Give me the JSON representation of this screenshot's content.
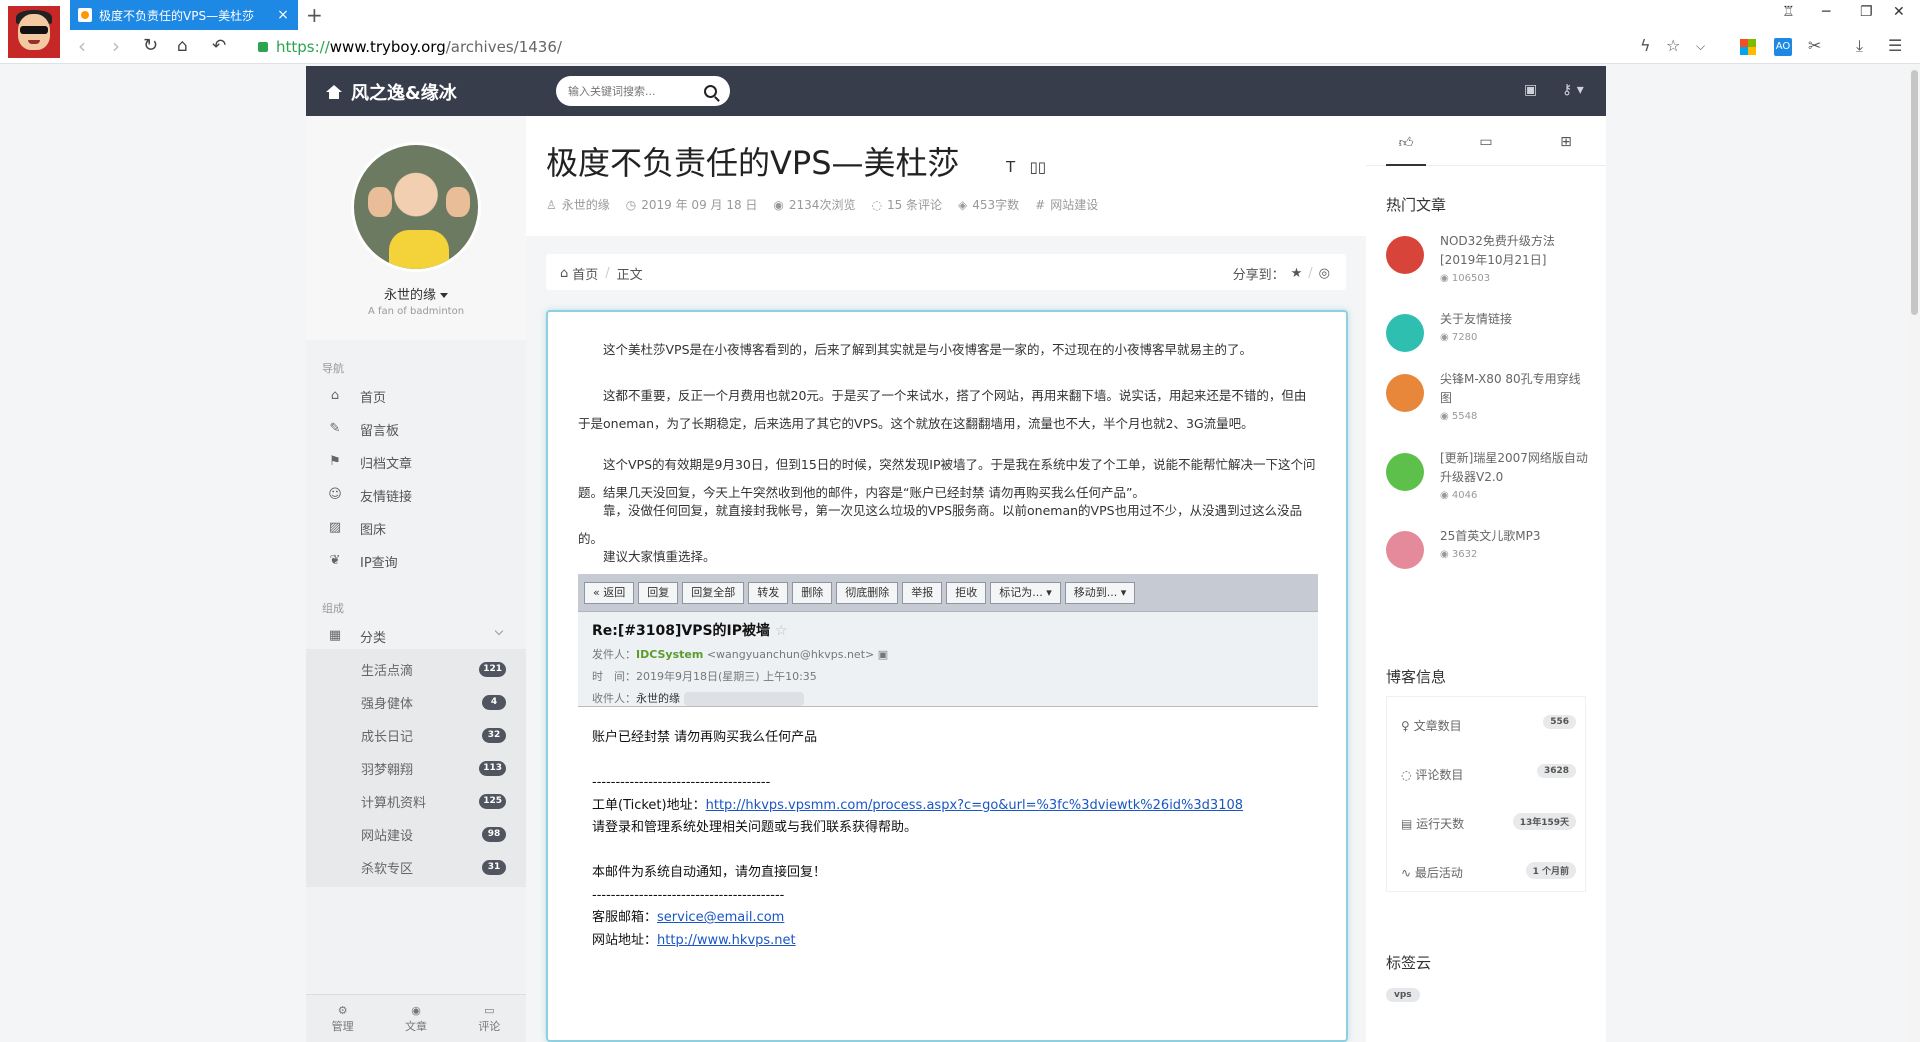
{
  "browser": {
    "tab_title": "极度不负责任的VPS—美杜莎",
    "url_scheme": "https://",
    "url_host": "www.tryboy.org",
    "url_path": "/archives/1436/",
    "new_tab": "+"
  },
  "header": {
    "brand": "风之逸&缘冰",
    "search_placeholder": "输入关键词搜索..."
  },
  "profile": {
    "name": "永世的缘",
    "desc": "A fan of badminton"
  },
  "nav": {
    "section_nav": "导航",
    "items": [
      {
        "label": "首页",
        "icon": "home-icon"
      },
      {
        "label": "留言板",
        "icon": "edit-icon"
      },
      {
        "label": "归档文章",
        "icon": "archive-icon"
      },
      {
        "label": "友情链接",
        "icon": "friends-icon"
      },
      {
        "label": "图床",
        "icon": "image-icon"
      },
      {
        "label": "IP查询",
        "icon": "twitter-icon"
      }
    ],
    "section_group": "组成",
    "category_label": "分类",
    "categories": [
      {
        "label": "生活点滴",
        "count": "121"
      },
      {
        "label": "强身健体",
        "count": "4"
      },
      {
        "label": "成长日记",
        "count": "32"
      },
      {
        "label": "羽梦翱翔",
        "count": "113"
      },
      {
        "label": "计算机资料",
        "count": "125"
      },
      {
        "label": "网站建设",
        "count": "98"
      },
      {
        "label": "杀软专区",
        "count": "31"
      }
    ],
    "footer": {
      "manage": "管理",
      "articles": "文章",
      "comments": "评论"
    }
  },
  "article": {
    "title": "极度不负责任的VPS—美杜莎",
    "meta": {
      "author": "永世的缘",
      "date": "2019 年 09 月 18 日",
      "views": "2134次浏览",
      "comments": "15 条评论",
      "words": "453字数",
      "category": "网站建设"
    },
    "breadcrumb": {
      "home": "首页",
      "current": "正文"
    },
    "share_label": "分享到：",
    "paragraphs": [
      "这个美杜莎VPS是在小夜博客看到的，后来了解到其实就是与小夜博客是一家的，不过现在的小夜博客早就易主的了。",
      "这都不重要，反正一个月费用也就20元。于是买了一个来试水，搭了个网站，再用来翻下墙。说实话，用起来还是不错的，但由于是oneman，为了长期稳定，后来选用了其它的VPS。这个就放在这翻翻墙用，流量也不大，半个月也就2、3G流量吧。",
      "这个VPS的有效期是9月30日，但到15日的时候，突然发现IP被墙了。于是我在系统中发了个工单，说能不能帮忙解决一下这个问题。结果几天没回复，今天上午突然收到他的邮件，内容是“账户已经封禁 请勿再购买我么任何产品”。",
      "靠，没做任何回复，就直接封我帐号，第一次见这么垃圾的VPS服务商。以前oneman的VPS也用过不少，从没遇到过这么没品的。",
      "建议大家慎重选择。"
    ],
    "email": {
      "toolbar": [
        "« 返回",
        "回复",
        "回复全部",
        "转发",
        "删除",
        "彻底删除",
        "举报",
        "拒收",
        "标记为... ▾",
        "移动到... ▾"
      ],
      "subject": "Re:[#3108]VPS的IP被墙",
      "from_label": "发件人：",
      "from_name": "IDCSystem",
      "from_addr": "<wangyuanchun@hkvps.net>",
      "time_label": "时　间：",
      "time": "2019年9月18日(星期三) 上午10:35",
      "to_label": "收件人：",
      "to": "永世的缘",
      "body_line1": "账户已经封禁 请勿再购买我么任何产品",
      "divider": "--------------------------------------",
      "ticket_label": "工单(Ticket)地址：",
      "ticket_url": "http://hkvps.vpsmm.com/process.aspx?c=go&url=%3fc%3dviewtk%26id%3d3108",
      "body_line2": "请登录和管理系统处理相关问题或与我们联系获得帮助。",
      "body_line3": "本邮件为系统自动通知，请勿直接回复！",
      "divider2": "-----------------------------------------",
      "service_label": "客服邮箱：",
      "service_email": "service@email.com",
      "site_label": "网站地址：",
      "site_url": "http://www.hkvps.net"
    }
  },
  "sidebar": {
    "hot_title": "热门文章",
    "hot": [
      {
        "title": "NOD32免费升级方法[2019年10月21日]",
        "views": "106503",
        "color": "#d9443a"
      },
      {
        "title": "关于友情链接",
        "views": "7280",
        "color": "#2fbfb0"
      },
      {
        "title": "尖锋M-X80 80孔专用穿线图",
        "views": "5548",
        "color": "#e8873a"
      },
      {
        "title": "[更新]瑞星2007网络版自动升级器V2.0",
        "views": "4046",
        "color": "#5cc04a"
      },
      {
        "title": "25首英文儿歌MP3",
        "views": "3632",
        "color": "#e58a9a"
      }
    ],
    "info_title": "博客信息",
    "info": [
      {
        "label": "文章数目",
        "value": "556"
      },
      {
        "label": "评论数目",
        "value": "3628"
      },
      {
        "label": "运行天数",
        "value": "13年159天"
      },
      {
        "label": "最后活动",
        "value": "1 个月前"
      }
    ],
    "tags_title": "标签云",
    "tags": [
      "vps"
    ]
  }
}
